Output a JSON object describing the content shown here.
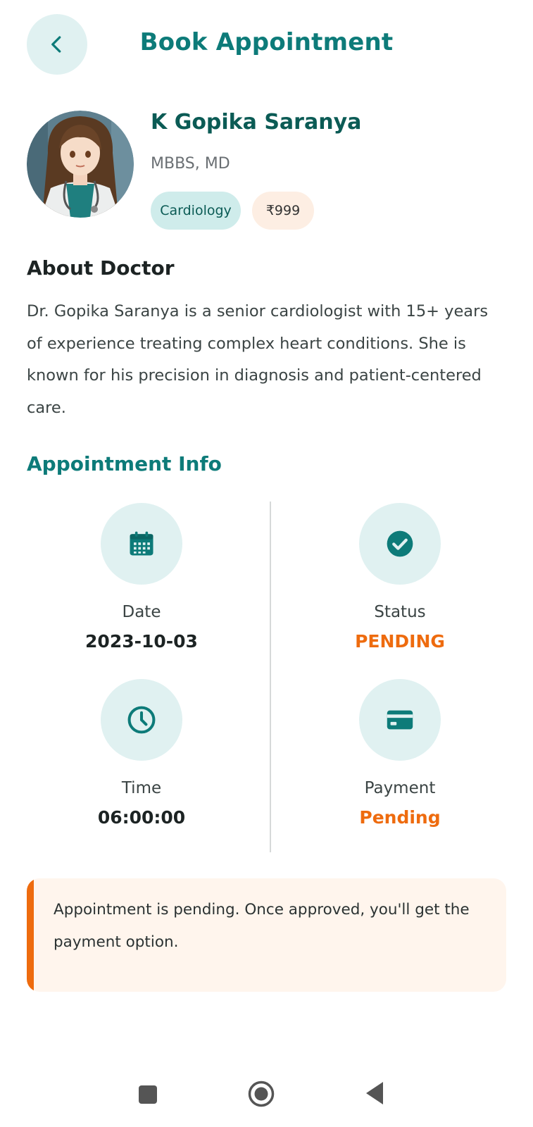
{
  "header": {
    "title": "Book Appointment",
    "back_icon": "chevron-left-icon"
  },
  "doctor": {
    "name": "K Gopika Saranya",
    "degree": "MBBS, MD",
    "specialty": "Cardiology",
    "fee": "₹999"
  },
  "about": {
    "heading": "About Doctor",
    "text": "Dr. Gopika Saranya is a senior cardiologist with 15+ years of experience treating complex heart conditions. She is known for his precision in diagnosis and patient-centered care."
  },
  "appointment_info": {
    "heading": "Appointment Info",
    "date": {
      "label": "Date",
      "value": "2023-10-03",
      "icon": "calendar-icon"
    },
    "status": {
      "label": "Status",
      "value": "PENDING",
      "icon": "check-circle-icon"
    },
    "time": {
      "label": "Time",
      "value": "06:00:00",
      "icon": "clock-icon"
    },
    "payment": {
      "label": "Payment",
      "value": "Pending",
      "icon": "credit-card-icon"
    }
  },
  "notice": {
    "text": "Appointment is pending. Once approved, you'll get the payment option."
  },
  "colors": {
    "primary": "#0d7b79",
    "accent_orange": "#ee6b0e",
    "icon_bg": "#e0f1f1",
    "notice_bg": "#fff5ed"
  },
  "system_nav": {
    "recents_icon": "square-icon",
    "home_icon": "circle-home-icon",
    "back_icon": "triangle-back-icon"
  }
}
